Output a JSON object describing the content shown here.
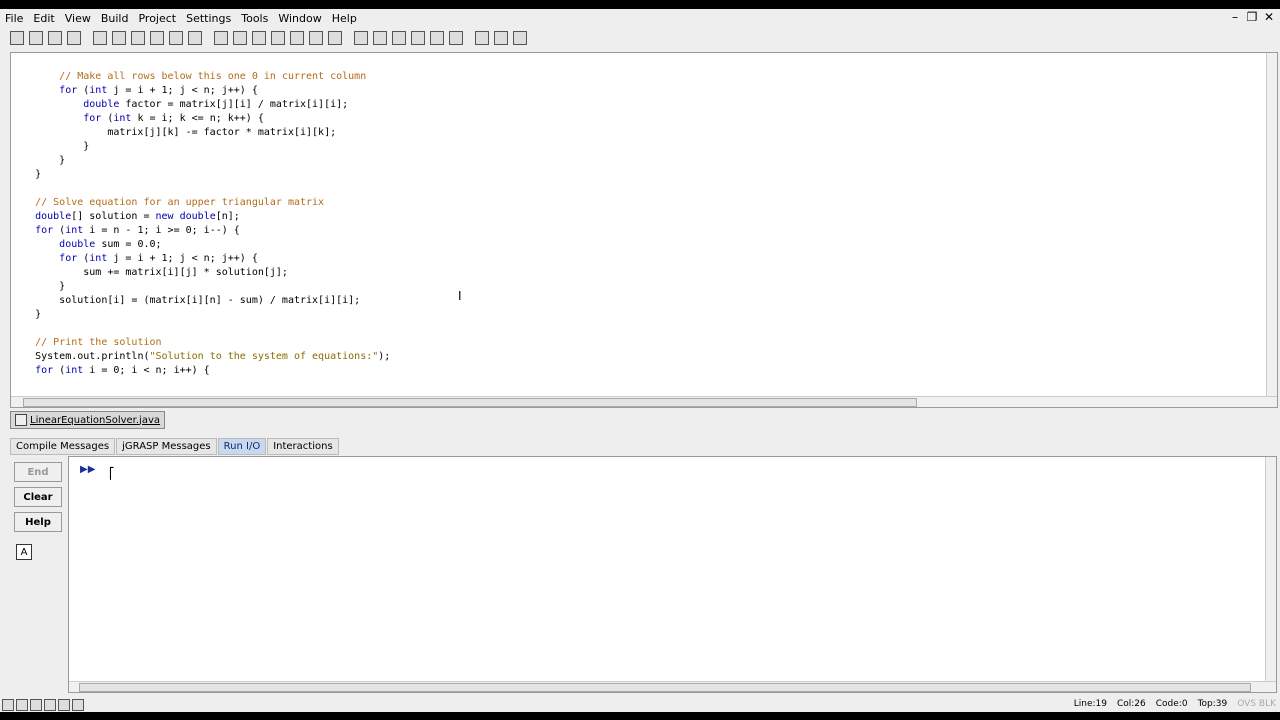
{
  "menu": {
    "items": [
      "File",
      "Edit",
      "View",
      "Build",
      "Project",
      "Settings",
      "Tools",
      "Window",
      "Help"
    ]
  },
  "toolbar": {
    "icons": [
      "open-icon",
      "save-icon",
      "save-all-icon",
      "print-icon",
      "cut-icon",
      "copy-icon",
      "paste-icon",
      "undo-icon",
      "redo-icon",
      "font-icon",
      "generate-csd-icon",
      "remove-csd-icon",
      "fold-icon",
      "unfold-icon",
      "cpg-icon",
      "uml-icon",
      "browse-icon",
      "compile-icon",
      "run-icon",
      "debug-icon",
      "step-icon",
      "workbench-icon",
      "interactions-icon",
      "checkstyle-icon",
      "junit-icon",
      "doc-icon"
    ]
  },
  "editor": {
    "lines": [
      {
        "indent": "        ",
        "parts": [
          {
            "c": "cm",
            "t": "// Make all rows below this one 0 in current column"
          }
        ]
      },
      {
        "indent": "        ",
        "parts": [
          {
            "c": "kw",
            "t": "for"
          },
          {
            "c": "",
            "t": " ("
          },
          {
            "c": "kw",
            "t": "int"
          },
          {
            "c": "",
            "t": " j = i + 1; j < n; j++) {"
          }
        ]
      },
      {
        "indent": "            ",
        "parts": [
          {
            "c": "kw",
            "t": "double"
          },
          {
            "c": "",
            "t": " factor = matrix[j][i] / matrix[i][i];"
          }
        ]
      },
      {
        "indent": "            ",
        "parts": [
          {
            "c": "kw",
            "t": "for"
          },
          {
            "c": "",
            "t": " ("
          },
          {
            "c": "kw",
            "t": "int"
          },
          {
            "c": "",
            "t": " k = i; k <= n; k++) {"
          }
        ]
      },
      {
        "indent": "                ",
        "parts": [
          {
            "c": "",
            "t": "matrix[j][k] -= factor * matrix[i][k];"
          }
        ]
      },
      {
        "indent": "            ",
        "parts": [
          {
            "c": "",
            "t": "}"
          }
        ]
      },
      {
        "indent": "        ",
        "parts": [
          {
            "c": "",
            "t": "}"
          }
        ]
      },
      {
        "indent": "    ",
        "parts": [
          {
            "c": "",
            "t": "}"
          }
        ]
      },
      {
        "indent": "",
        "parts": [
          {
            "c": "",
            "t": ""
          }
        ]
      },
      {
        "indent": "    ",
        "parts": [
          {
            "c": "cm",
            "t": "// Solve equation for an upper triangular matrix"
          }
        ]
      },
      {
        "indent": "    ",
        "parts": [
          {
            "c": "kw",
            "t": "double"
          },
          {
            "c": "",
            "t": "[] solution = "
          },
          {
            "c": "kw",
            "t": "new"
          },
          {
            "c": "",
            "t": " "
          },
          {
            "c": "kw",
            "t": "double"
          },
          {
            "c": "",
            "t": "[n];"
          }
        ]
      },
      {
        "indent": "    ",
        "parts": [
          {
            "c": "kw",
            "t": "for"
          },
          {
            "c": "",
            "t": " ("
          },
          {
            "c": "kw",
            "t": "int"
          },
          {
            "c": "",
            "t": " i = n - 1; i >= 0; i--) {"
          }
        ]
      },
      {
        "indent": "        ",
        "parts": [
          {
            "c": "kw",
            "t": "double"
          },
          {
            "c": "",
            "t": " sum = 0.0;"
          }
        ]
      },
      {
        "indent": "        ",
        "parts": [
          {
            "c": "kw",
            "t": "for"
          },
          {
            "c": "",
            "t": " ("
          },
          {
            "c": "kw",
            "t": "int"
          },
          {
            "c": "",
            "t": " j = i + 1; j < n; j++) {"
          }
        ]
      },
      {
        "indent": "            ",
        "parts": [
          {
            "c": "",
            "t": "sum += matrix[i][j] * solution[j];"
          }
        ]
      },
      {
        "indent": "        ",
        "parts": [
          {
            "c": "",
            "t": "}"
          }
        ]
      },
      {
        "indent": "        ",
        "parts": [
          {
            "c": "",
            "t": "solution[i] = (matrix[i][n] - sum) / matrix[i][i];"
          }
        ]
      },
      {
        "indent": "    ",
        "parts": [
          {
            "c": "",
            "t": "}"
          }
        ]
      },
      {
        "indent": "",
        "parts": [
          {
            "c": "",
            "t": ""
          }
        ]
      },
      {
        "indent": "    ",
        "parts": [
          {
            "c": "cm",
            "t": "// Print the solution"
          }
        ]
      },
      {
        "indent": "    ",
        "parts": [
          {
            "c": "",
            "t": "System.out.println("
          },
          {
            "c": "st",
            "t": "\"Solution to the system of equations:\""
          },
          {
            "c": "",
            "t": ");"
          }
        ]
      },
      {
        "indent": "    ",
        "parts": [
          {
            "c": "kw",
            "t": "for"
          },
          {
            "c": "",
            "t": " ("
          },
          {
            "c": "kw",
            "t": "int"
          },
          {
            "c": "",
            "t": " i = 0; i < n; i++) {"
          }
        ]
      }
    ]
  },
  "file_tab": {
    "label": "LinearEquationSolver.java"
  },
  "message_tabs": [
    {
      "label": "Compile Messages",
      "active": false
    },
    {
      "label": "jGRASP Messages",
      "active": false
    },
    {
      "label": "Run I/O",
      "active": true
    },
    {
      "label": "Interactions",
      "active": false
    }
  ],
  "run_io": {
    "end_label": "End",
    "clear_label": "Clear",
    "help_label": "Help",
    "font_label": "A",
    "prompt": "▶▶"
  },
  "status": {
    "line": "Line:19",
    "col": "Col:26",
    "code": "Code:0",
    "top": "Top:39",
    "flags": "OVS BLK"
  }
}
